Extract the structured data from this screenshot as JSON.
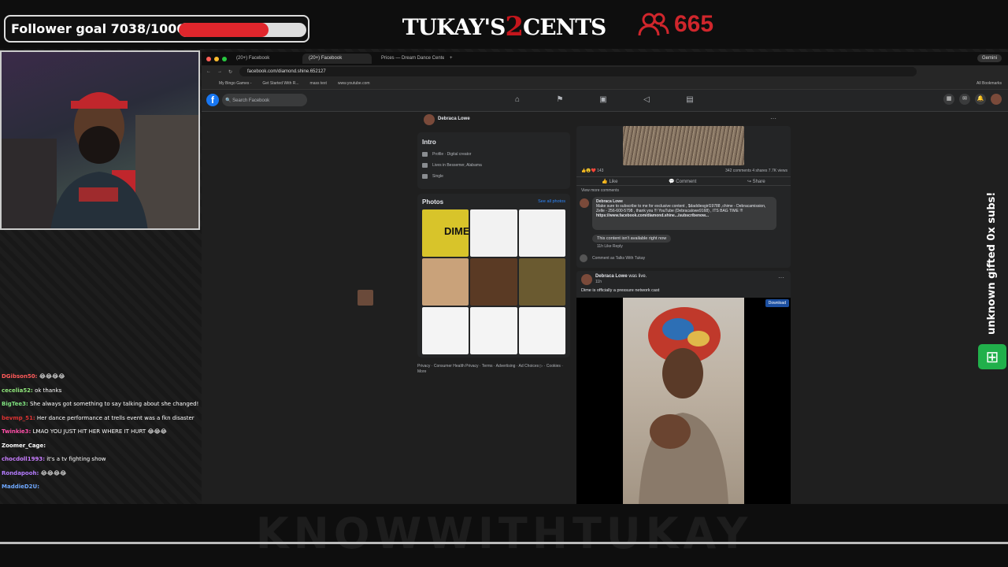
{
  "overlay": {
    "follower_goal": "Follower goal 7038/10000",
    "follower_progress": 0.7038,
    "logo_left": "TUKAY'S",
    "logo_num": "2",
    "logo_right": "CENTS",
    "viewers": "665",
    "subs_banner": "unknown gifted 0x subs!",
    "bottom_watermark": "KNOWWITHTUKAY"
  },
  "chat": [
    {
      "user": "DGibson50:",
      "text": "😂😂😂😂",
      "color": "#ff5a5a"
    },
    {
      "user": "cecelia52:",
      "text": "ok thanks",
      "color": "#8fe57a"
    },
    {
      "user": "BigTee3:",
      "text": "She always got something to say talking about she changed!",
      "color": "#7ee07e"
    },
    {
      "user": "bevmp_51:",
      "text": "Her dance performance at trells event was a fkn disaster",
      "color": "#d33"
    },
    {
      "user": "Twinkie3:",
      "text": "LMAO YOU JUST HIT HER WHERE IT HURT 😂😂😂",
      "color": "#ff4fa8"
    },
    {
      "user": "Zoomer_Cage:",
      "text": "",
      "color": "#fff"
    },
    {
      "user": "chocdoll1993:",
      "text": "it's a tv fighting show",
      "color": "#c77dff"
    },
    {
      "user": "Rondapooh:",
      "text": "😂😂😂😂",
      "color": "#b57cff"
    },
    {
      "user": "MaddieD2U:",
      "text": "",
      "color": "#6fa8ff"
    }
  ],
  "browser": {
    "tabs": [
      "(20+) Facebook",
      "(20+) Facebook",
      "Prices — Dream Dance Cente"
    ],
    "gemini": "Gemini",
    "url": "facebook.com/diamond.shine.652127",
    "bookmarks": [
      "My Bingo Games -",
      "Get Started With R...",
      "mass text",
      "www.youtube.com"
    ],
    "all_bookmarks": "All Bookmarks"
  },
  "fb": {
    "search_placeholder": "Search Facebook",
    "profile_name": "Debraca Lowe",
    "intro_title": "Intro",
    "intro_profile": "Profile · Digital creator",
    "intro_lives": "Lives in Bessemer, Alabama",
    "intro_single": "Single",
    "photos_title": "Photos",
    "see_all": "See all photos",
    "photo_dime": "DIME",
    "footer": "Privacy · Consumer Health Privacy · Terms · Advertising · Ad Choices ▷ · Cookies · More",
    "post1": {
      "reactions": "143",
      "stats": "342 comments  4 shares  7.7K views",
      "like": "Like",
      "comment": "Comment",
      "share": "Share",
      "view_more": "View more comments",
      "comment_author": "Debraca Lowe",
      "comment_text": "Make sure to subscribe to me for exclusive content , $daddiesgirl19788 ,chime - Debracamission, Zelle - 256-600-5798 , thank you !!! YouTube (Debracalowe9168) , ITS BAG TIME !!!",
      "comment_link": "https://www.facebook.com/diamond.shine.../subscribenow...",
      "unavailable": "This content isn't available right now",
      "comment_meta": "11h   Like   Reply",
      "comment_as": "Comment as Talks With Tukay"
    },
    "post2": {
      "author": "Debraca Lowe",
      "status": "was live.",
      "time": "11h",
      "text": "Dime is officially a pressure network cast",
      "download": "Download"
    }
  }
}
